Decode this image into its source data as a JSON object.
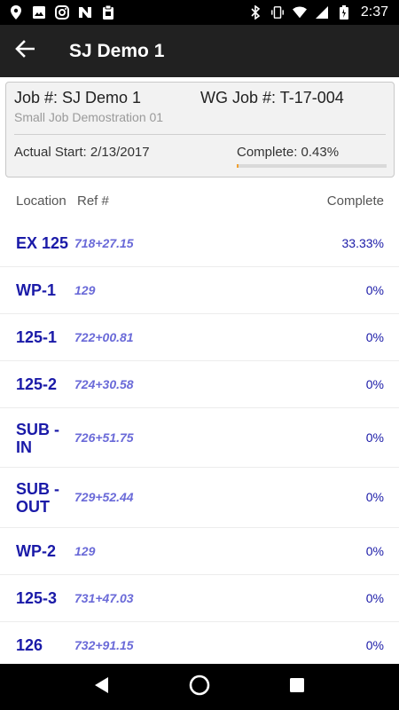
{
  "status_bar": {
    "time": "2:37",
    "left_icons": [
      "maps-pin-icon",
      "image-icon",
      "instagram-icon",
      "n-app-icon",
      "clipboard-icon"
    ],
    "right_icons": [
      "bluetooth-icon",
      "vibrate-icon",
      "wifi-icon",
      "signal-icon",
      "battery-icon"
    ]
  },
  "app_bar": {
    "title": "SJ Demo 1",
    "back_icon": "arrow-back-icon"
  },
  "job": {
    "job_number": "Job #: SJ Demo 1",
    "wg_job": "WG Job #: T-17-004",
    "description": "Small Job Demostration 01",
    "actual_start": "Actual Start: 2/13/2017",
    "complete_label": "Complete: 0.43%",
    "complete_fraction": 0.0043,
    "progress_color": "#f0a030"
  },
  "table": {
    "headers": {
      "location": "Location",
      "ref": "Ref #",
      "complete": "Complete"
    },
    "rows": [
      {
        "location": "EX 125",
        "ref": "718+27.15",
        "complete": "33.33%"
      },
      {
        "location": "WP-1",
        "ref": "129",
        "complete": "0%"
      },
      {
        "location": "125-1",
        "ref": "722+00.81",
        "complete": "0%"
      },
      {
        "location": "125-2",
        "ref": "724+30.58",
        "complete": "0%"
      },
      {
        "location": "SUB - IN",
        "ref": "726+51.75",
        "complete": "0%"
      },
      {
        "location": "SUB - OUT",
        "ref": "729+52.44",
        "complete": "0%"
      },
      {
        "location": "WP-2",
        "ref": "129",
        "complete": "0%"
      },
      {
        "location": "125-3",
        "ref": "731+47.03",
        "complete": "0%"
      },
      {
        "location": "126",
        "ref": "732+91.15",
        "complete": "0%"
      }
    ]
  },
  "nav_bar": {
    "icons": [
      "back-triangle-icon",
      "home-circle-icon",
      "recents-square-icon"
    ]
  },
  "colors": {
    "location_text": "#1a1aa8",
    "ref_text": "#6a6ad8",
    "app_bar": "#212121"
  }
}
